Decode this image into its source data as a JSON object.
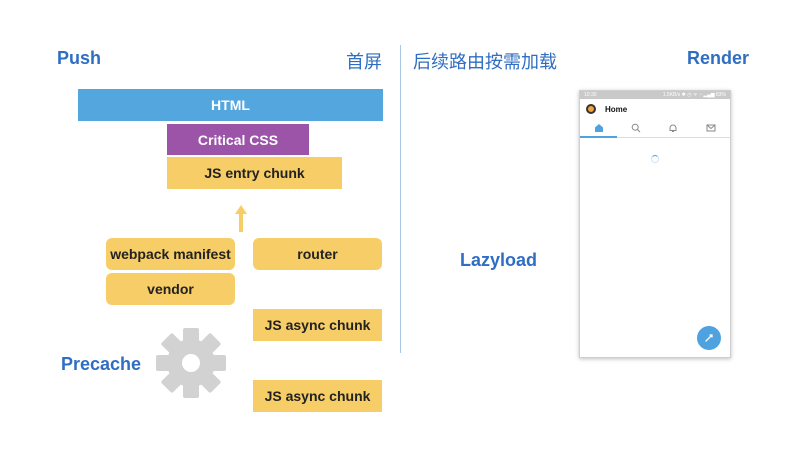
{
  "labels": {
    "push": "Push",
    "first_screen": "首屏",
    "lazy_on_demand": "后续路由按需加载",
    "render": "Render",
    "lazyload": "Lazyload",
    "precache": "Precache"
  },
  "push_stack": {
    "html": "HTML",
    "critical_css": "Critical CSS",
    "js_entry": "JS entry chunk"
  },
  "precache_items": {
    "webpack_manifest": "webpack manifest",
    "router": "router",
    "vendor": "vendor",
    "js_async_1": "JS async chunk",
    "js_async_2": "JS async chunk"
  },
  "phone": {
    "status_left": "10:30",
    "status_right": "1.5KB/s ✱ ◷ ᯤ ◔ ▂▄▆ 83%",
    "title": "Home"
  },
  "colors": {
    "accent_text": "#2f6ec2",
    "html_bar": "#53a6de",
    "css_bar": "#9b54a8",
    "chunk": "#f6cd66",
    "gear": "#d2d2d2",
    "phone_accent": "#4ea2e0"
  },
  "icons": [
    "up-arrow-icon",
    "gear-icon",
    "pointing-hand-icon",
    "home-tab-icon",
    "search-tab-icon",
    "bell-tab-icon",
    "mail-tab-icon",
    "compose-fab-icon",
    "loading-spinner"
  ]
}
